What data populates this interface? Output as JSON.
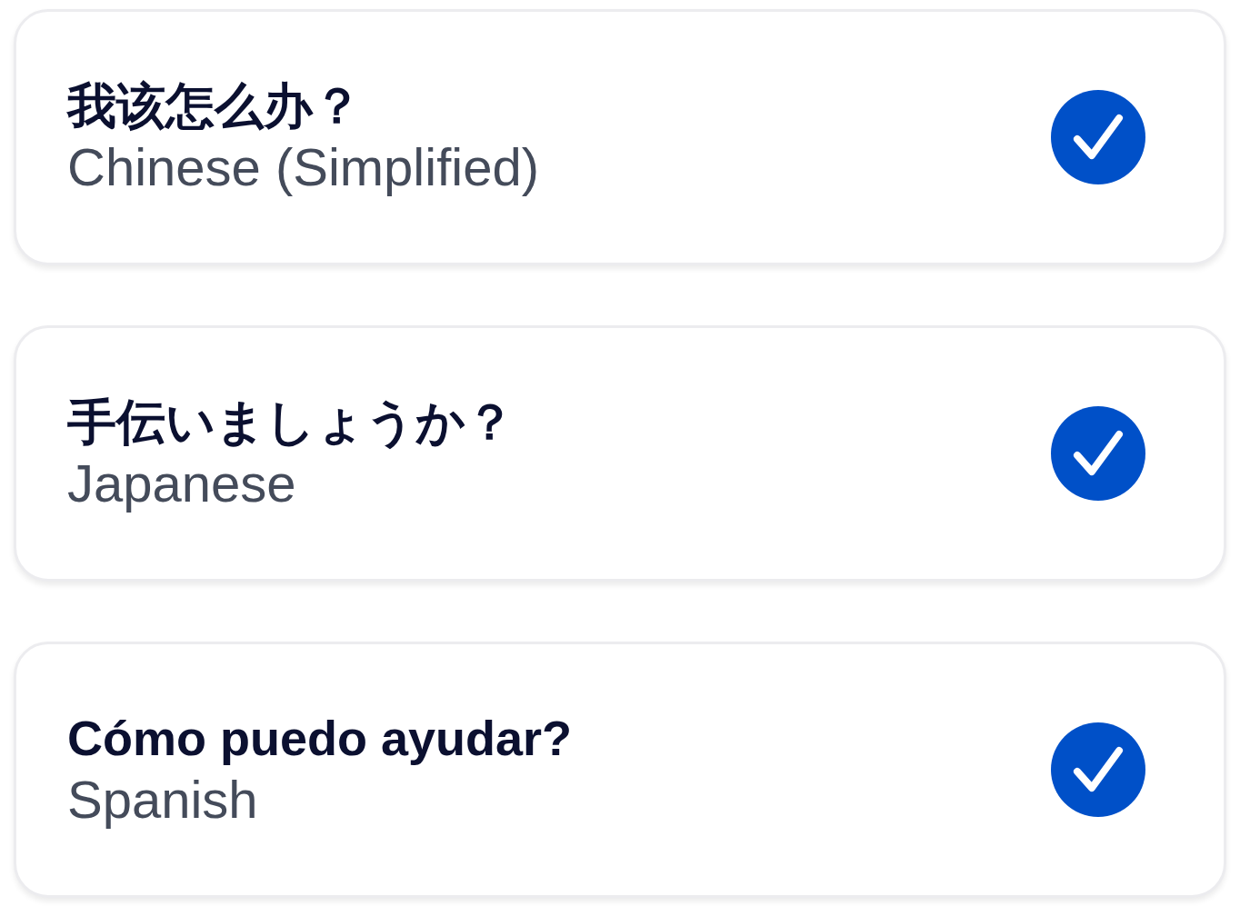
{
  "items": [
    {
      "title": "我该怎么办？",
      "language": "Chinese (Simplified)",
      "checked": true
    },
    {
      "title": "手伝いましょうか？",
      "language": "Japanese",
      "checked": true
    },
    {
      "title": "Cómo puedo ayudar?",
      "language": "Spanish",
      "checked": true
    }
  ]
}
